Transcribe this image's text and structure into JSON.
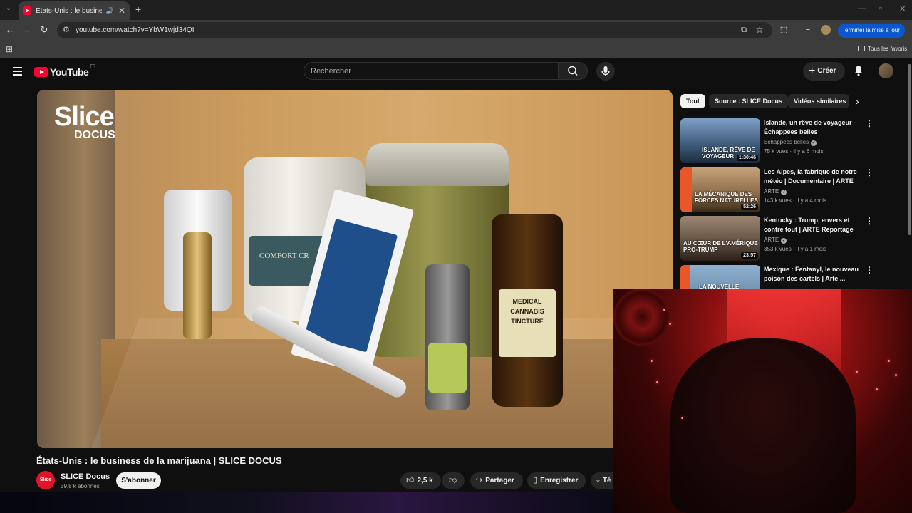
{
  "browser": {
    "tab_title": "États-Unis : le business de la marijuana",
    "url": "youtube.com/watch?v=YbW1wjd34QI",
    "update_label": "Terminer la mise à jour",
    "all_favorites": "Tous les favoris"
  },
  "youtube": {
    "logo_text": "YouTube",
    "country_code": "FR",
    "search_placeholder": "Rechercher",
    "create_label": "Créer"
  },
  "player": {
    "watermark_line1": "Slice",
    "watermark_line2": "DOCUS",
    "jar_label": "COMFORT CR",
    "tincture_label": "MEDICAL CANNABIS TINCTURE"
  },
  "video": {
    "title": "États-Unis : le business de la marijuana | SLICE DOCUS",
    "channel_avatar_text": "Slice",
    "channel_name": "SLICE Docus",
    "subscribers": "39,8 k abonnés",
    "subscribe_label": "S'abonner",
    "likes": "2,5 k",
    "share_label": "Partager",
    "save_label": "Enregistrer",
    "download_label": "Té"
  },
  "chips": [
    "Tout",
    "Source : SLICE Docus",
    "Vidéos similaires"
  ],
  "recommendations": [
    {
      "title": "Islande, un rêve de voyageur - Échappées belles",
      "channel": "Echappées belles",
      "meta": "75 k vues · il y a 6 mois",
      "duration": "1:30:46",
      "thumb_text": "ISLANDE, RÊVE DE VOYAGEUR",
      "thumb_color": "#3d5a78"
    },
    {
      "title": "Les Alpes, la fabrique de notre météo | Documentaire | ARTE",
      "channel": "ARTE",
      "meta": "143 k vues · il y a 4 mois",
      "duration": "52:26",
      "thumb_text": "LA MÉCANIQUE DES FORCES NATURELLES",
      "thumb_color": "#8a6a48"
    },
    {
      "title": "Kentucky : Trump, envers et contre tout | ARTE Reportage",
      "channel": "ARTE",
      "meta": "353 k vues · il y a 1 mois",
      "duration": "23:57",
      "thumb_text": "AU CŒUR DE L'AMÉRIQUE PRO-TRUMP",
      "thumb_color": "#6b5a4a"
    },
    {
      "title": "Mexique : Fentanyl, le nouveau poison des cartels | Arte ...",
      "channel": "",
      "meta": "",
      "duration": "",
      "thumb_text": "LA NOUVELLE",
      "thumb_color": "#5d7f9e"
    }
  ]
}
